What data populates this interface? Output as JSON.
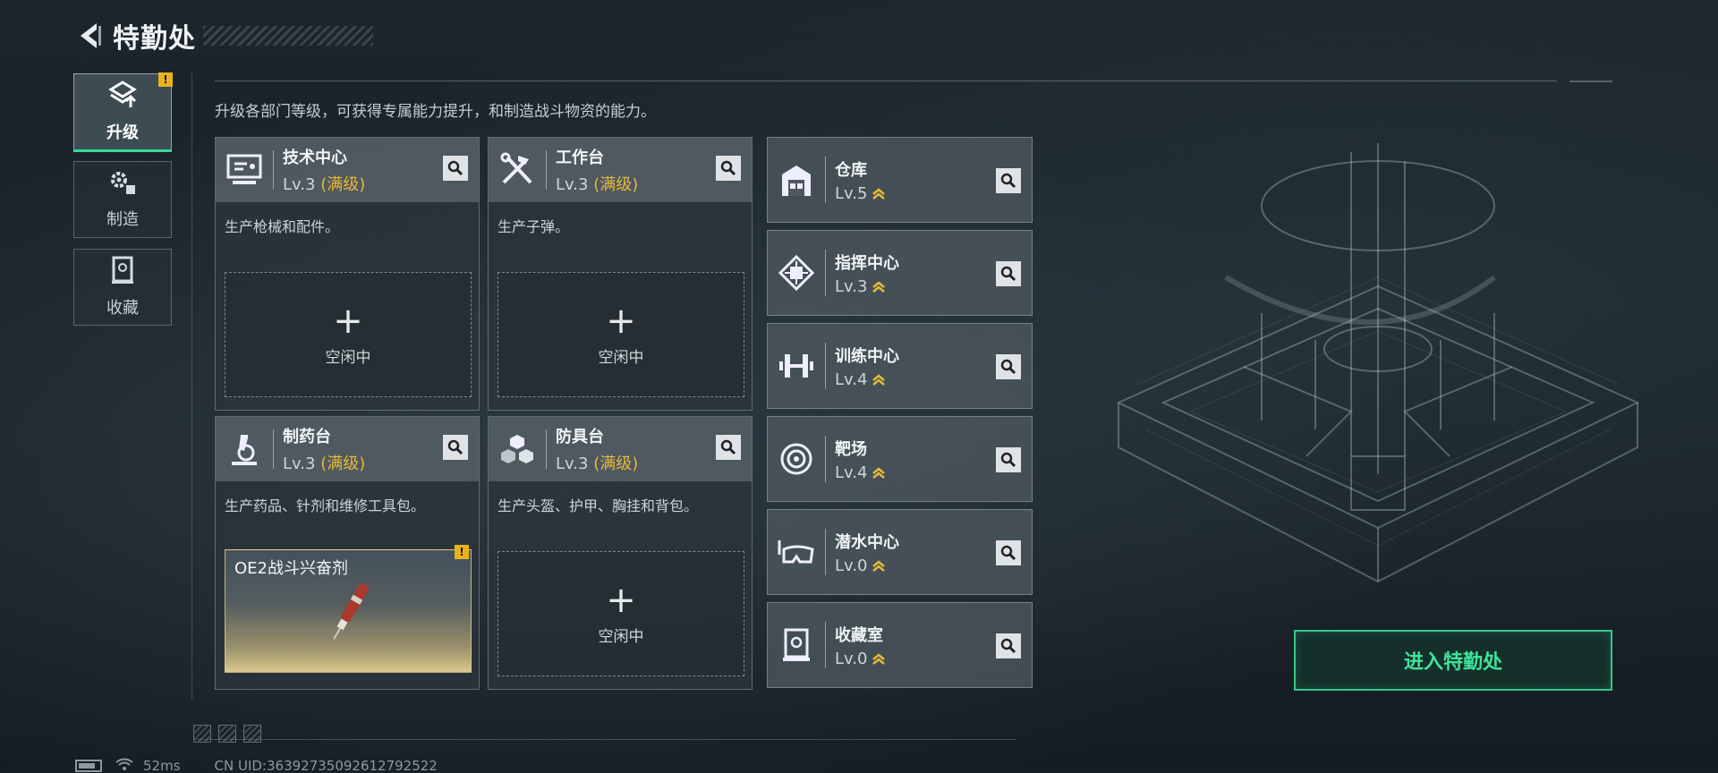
{
  "header": {
    "title": "特勤处",
    "back_icon": "back-arrow-icon"
  },
  "sidenav": [
    {
      "label": "升级",
      "icon": "upgrade-icon",
      "active": true,
      "alert": "!"
    },
    {
      "label": "制造",
      "icon": "gears-icon",
      "active": false
    },
    {
      "label": "收藏",
      "icon": "collection-icon",
      "active": false
    }
  ],
  "description": "升级各部门等级，可获得专属能力提升，和制造战斗物资的能力。",
  "big_cards": [
    {
      "name": "技术中心",
      "level": "Lv.3",
      "max_label": "(满级)",
      "desc": "生产枪械和配件。",
      "slot_plus": "+",
      "slot_text": "空闲中"
    },
    {
      "name": "工作台",
      "level": "Lv.3",
      "max_label": "(满级)",
      "desc": "生产子弹。",
      "slot_plus": "+",
      "slot_text": "空闲中"
    },
    {
      "name": "制药台",
      "level": "Lv.3",
      "max_label": "(满级)",
      "desc": "生产药品、针剂和维修工具包。",
      "craft_item": "OE2战斗兴奋剂",
      "craft_alert": "!"
    },
    {
      "name": "防具台",
      "level": "Lv.3",
      "max_label": "(满级)",
      "desc": "生产头盔、护甲、胸挂和背包。",
      "slot_plus": "+",
      "slot_text": "空闲中"
    }
  ],
  "small_cards": [
    {
      "name": "仓库",
      "level": "Lv.5",
      "icon": "warehouse-icon"
    },
    {
      "name": "指挥中心",
      "level": "Lv.3",
      "icon": "command-chip-icon"
    },
    {
      "name": "训练中心",
      "level": "Lv.4",
      "icon": "dumbbell-icon"
    },
    {
      "name": "靶场",
      "level": "Lv.4",
      "icon": "target-icon"
    },
    {
      "name": "潜水中心",
      "level": "Lv.0",
      "icon": "diving-mask-icon"
    },
    {
      "name": "收藏室",
      "level": "Lv.0",
      "icon": "display-case-icon"
    }
  ],
  "enter_button": "进入特勤处",
  "status": {
    "ping": "52ms",
    "uid": "CN UID:36392735092612792522"
  },
  "colors": {
    "accent_green": "#3fe39b",
    "max_gold": "#e6b93a",
    "alert_yellow": "#e8b21c"
  }
}
